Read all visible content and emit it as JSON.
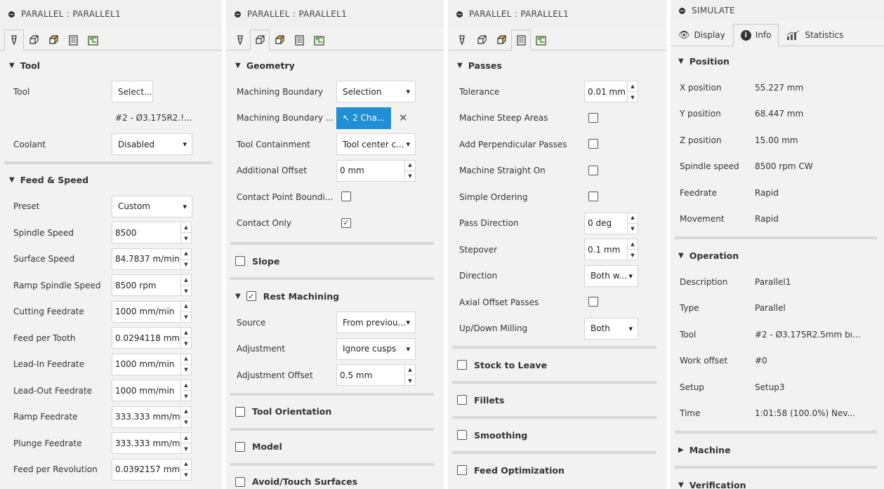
{
  "tool_panel": {
    "title": "PARALLEL : PARALLEL1",
    "sections": {
      "tool": "Tool",
      "feed_speed": "Feed & Speed"
    },
    "tool_label": "Tool",
    "tool_select": "Select...",
    "tool_name": "#2 - Ø3.175R2.!...",
    "coolant_label": "Coolant",
    "coolant_value": "Disabled",
    "preset_label": "Preset",
    "preset_value": "Custom",
    "fields": [
      {
        "label": "Spindle Speed",
        "value": "8500"
      },
      {
        "label": "Surface Speed",
        "value": "84.7837 m/min"
      },
      {
        "label": "Ramp Spindle Speed",
        "value": "8500 rpm"
      },
      {
        "label": "Cutting Feedrate",
        "value": "1000 mm/min"
      },
      {
        "label": "Feed per Tooth",
        "value": "0.0294118 mm"
      },
      {
        "label": "Lead-In Feedrate",
        "value": "1000 mm/min"
      },
      {
        "label": "Lead-Out Feedrate",
        "value": "1000 mm/min"
      },
      {
        "label": "Ramp Feedrate",
        "value": "333.333 mm/mi"
      },
      {
        "label": "Plunge Feedrate",
        "value": "333.333 mm/mi"
      },
      {
        "label": "Feed per Revolution",
        "value": "0.0392157 mm"
      }
    ]
  },
  "geometry_panel": {
    "title": "PARALLEL : PARALLEL1",
    "section": "Geometry",
    "machining_boundary_label": "Machining Boundary",
    "machining_boundary_value": "Selection",
    "boundary_sel_label": "Machining Boundary ...",
    "boundary_sel_value": "2 Cha...",
    "tool_containment_label": "Tool Containment",
    "tool_containment_value": "Tool center c...",
    "additional_offset_label": "Additional Offset",
    "additional_offset_value": "0 mm",
    "contact_point_label": "Contact Point Boundi...",
    "contact_only_label": "Contact Only",
    "slope": "Slope",
    "rest_machining": "Rest Machining",
    "source_label": "Source",
    "source_value": "From previou...",
    "adjustment_label": "Adjustment",
    "adjustment_value": "Ignore cusps",
    "adjustment_offset_label": "Adjustment Offset",
    "adjustment_offset_value": "0.5 mm",
    "tool_orientation": "Tool Orientation",
    "model": "Model",
    "avoid": "Avoid/Touch Surfaces"
  },
  "passes_panel": {
    "title": "PARALLEL : PARALLEL1",
    "section": "Passes",
    "tolerance_label": "Tolerance",
    "tolerance_value": "0.01 mm",
    "checks": [
      "Machine Steep Areas",
      "Add Perpendicular Passes",
      "Machine Straight On",
      "Simple Ordering"
    ],
    "pass_direction_label": "Pass Direction",
    "pass_direction_value": "0 deg",
    "stepover_label": "Stepover",
    "stepover_value": "0.1 mm",
    "direction_label": "Direction",
    "direction_value": "Both w...",
    "axial_label": "Axial Offset Passes",
    "updown_label": "Up/Down Milling",
    "updown_value": "Both",
    "stock": "Stock to Leave",
    "fillets": "Fillets",
    "smoothing": "Smoothing",
    "feed_opt": "Feed Optimization"
  },
  "simulate_panel": {
    "title": "SIMULATE",
    "tabs": {
      "display": "Display",
      "info": "Info",
      "statistics": "Statistics"
    },
    "position_section": "Position",
    "position": [
      {
        "k": "X position",
        "v": "55.227 mm"
      },
      {
        "k": "Y position",
        "v": "68.447 mm"
      },
      {
        "k": "Z position",
        "v": "15.00 mm"
      },
      {
        "k": "Spindle speed",
        "v": "8500 rpm CW"
      },
      {
        "k": "Feedrate",
        "v": "Rapid"
      },
      {
        "k": "Movement",
        "v": "Rapid"
      }
    ],
    "operation_section": "Operation",
    "operation": [
      {
        "k": "Description",
        "v": "Parallel1"
      },
      {
        "k": "Type",
        "v": "Parallel"
      },
      {
        "k": "Tool",
        "v": "#2 - Ø3.175R2.5mm bı..."
      },
      {
        "k": "Work offset",
        "v": "#0"
      },
      {
        "k": "Setup",
        "v": "Setup3"
      },
      {
        "k": "Time",
        "v": "1:01:58 (100.0%) Nev..."
      }
    ],
    "machine_section": "Machine",
    "verification_section": "Verification"
  }
}
